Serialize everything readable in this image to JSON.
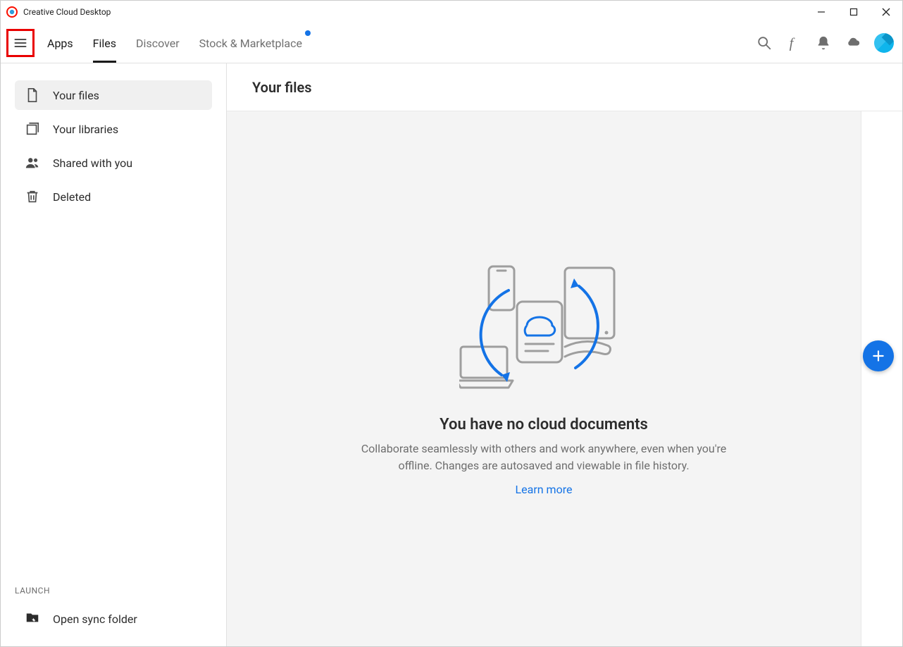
{
  "window": {
    "title": "Creative Cloud Desktop"
  },
  "tabs": {
    "apps": "Apps",
    "files": "Files",
    "discover": "Discover",
    "stock": "Stock & Marketplace"
  },
  "sidebar": {
    "items": [
      {
        "label": "Your files"
      },
      {
        "label": "Your libraries"
      },
      {
        "label": "Shared with you"
      },
      {
        "label": "Deleted"
      }
    ],
    "launch_label": "LAUNCH",
    "open_sync": "Open sync folder"
  },
  "main": {
    "title": "Your files",
    "empty_title": "You have no cloud documents",
    "empty_desc": "Collaborate seamlessly with others and work anywhere, even when you're offline. Changes are autosaved and viewable in file history.",
    "learn_more": "Learn more"
  }
}
